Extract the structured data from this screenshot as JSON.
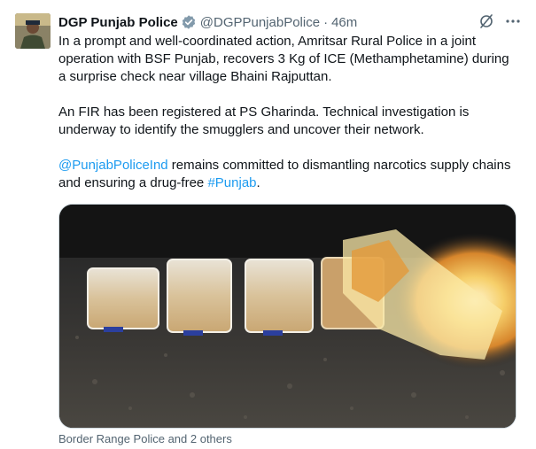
{
  "tweet": {
    "display_name": "DGP Punjab Police",
    "handle": "@DGPPunjabPolice",
    "separator": "·",
    "time": "46m",
    "paragraph1": "In a prompt and well-coordinated action, Amritsar Rural Police in a joint operation with BSF Punjab, recovers 3 Kg of ICE (Methamphetamine) during a surprise check near village Bhaini Rajputtan.",
    "paragraph2": "An FIR has been registered at PS Gharinda. Technical investigation is underway to identify the smugglers and uncover their network.",
    "mention": "@PunjabPoliceInd",
    "paragraph3_middle": " remains committed to dismantling narcotics supply chains and ensuring a drug-free ",
    "hashtag": "#Punjab",
    "paragraph3_end": ".",
    "media_tags": "Border Range Police and 2 others"
  },
  "icons": {
    "verified": "verified-badge-icon",
    "grok": "grok-icon",
    "more": "more-icon"
  },
  "colors": {
    "link": "#1d9bf0",
    "secondary_text": "#536471",
    "primary_text": "#0f1419"
  }
}
